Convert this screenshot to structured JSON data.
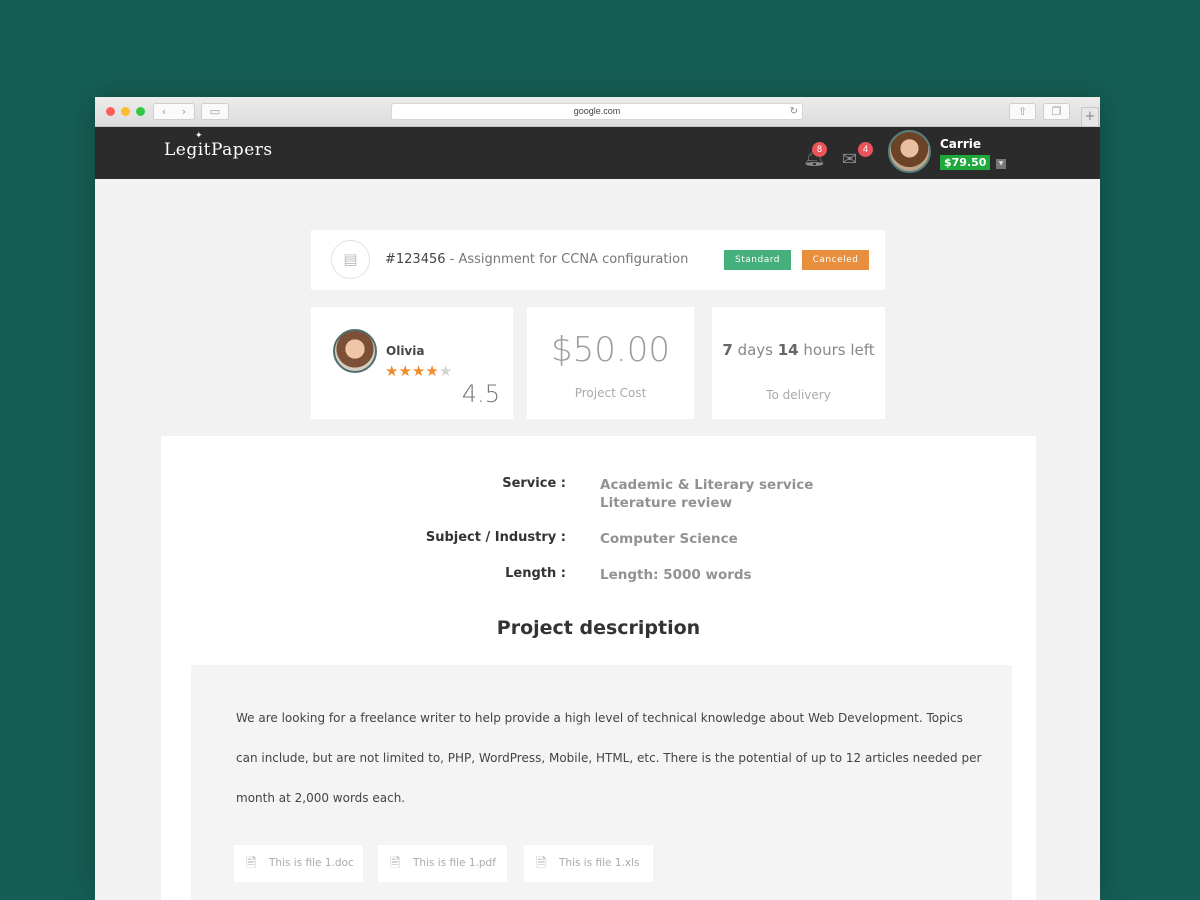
{
  "browser": {
    "url": "google.com",
    "back_icon": "‹",
    "forward_icon": "›",
    "new_tab": "+"
  },
  "header": {
    "logo": "LegitPapers",
    "notifications_count": "8",
    "messages_count": "4",
    "user_name": "Carrie",
    "balance": "$79.50"
  },
  "order": {
    "id": "#123456",
    "title": " - Assignment for CCNA configuration",
    "tag_standard": "Standard",
    "tag_canceled": "Canceled",
    "tag_standard_color": "#45b07b",
    "tag_canceled_color": "#e88e3d"
  },
  "writer": {
    "name": "Olivia",
    "stars_filled": 4,
    "stars_total": 5,
    "rating": "4.5"
  },
  "cost": {
    "value": "$50.00",
    "label": "Project Cost"
  },
  "delivery": {
    "days": "7",
    "days_unit": " days ",
    "hours": "14",
    "hours_unit": " hours left",
    "label": "To delivery"
  },
  "details": [
    {
      "label": "Service :",
      "value_line1": "Academic & Literary service",
      "value_line2": "Literature review"
    },
    {
      "label": "Subject / Industry :",
      "value_line1": "Computer Science"
    },
    {
      "label": "Length :",
      "value_line1": "Length: 5000 words"
    }
  ],
  "description": {
    "title": "Project description",
    "text": "We are looking for a freelance writer to help provide a high level of technical knowledge about Web Development. Topics can include, but are not limited to, PHP, WordPress, Mobile, HTML, etc. There is the potential of up to 12 articles needed per month at 2,000 words each.",
    "files": [
      "This is file 1.doc",
      "This is file 1.pdf",
      "This is file 1.xls"
    ]
  }
}
